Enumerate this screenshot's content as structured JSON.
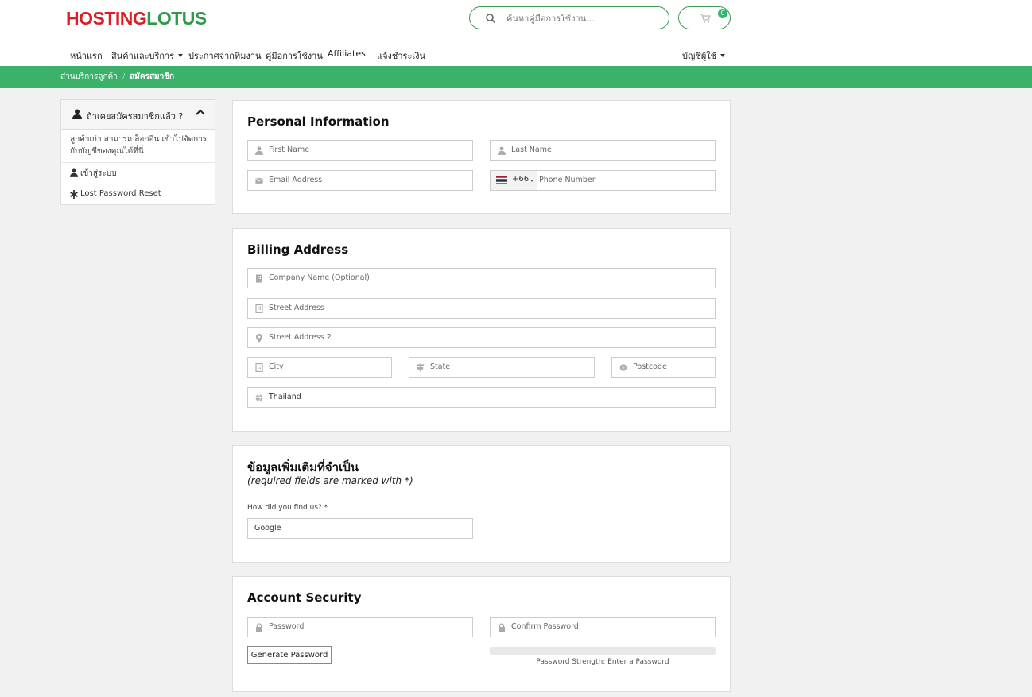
{
  "brand": {
    "part1": "HOSTING",
    "part2": "LOTUS",
    "color_red": "#d81f26",
    "color_green": "#2e9a47"
  },
  "search": {
    "placeholder": "ค้นหาคู่มือการใช้งาน..."
  },
  "cart": {
    "count": "0"
  },
  "nav": {
    "items": [
      "หน้าแรก",
      "สินค้าและบริการ",
      "ประกาศจากทีมงาน",
      "คู่มือการใช้งาน",
      "Affiliates",
      "แจ้งชำระเงิน"
    ],
    "account": "บัญชีผู้ใช้"
  },
  "breadcrumb": {
    "home": "ส่วนบริการลูกค้า",
    "sep": "/",
    "current": "สมัครสมาชิก"
  },
  "sidebar": {
    "title": "ถ้าเคยสมัครสมาชิกแล้ว ?",
    "text": "ลูกค้าเก่า สามารถ ล็อกอิน เข้าไปจัดการกับบัญชีของคุณได้ที่นี่",
    "login": "เข้าสู่ระบบ",
    "reset": "Lost Password Reset"
  },
  "personal": {
    "title": "Personal Information",
    "first_name": "First Name",
    "last_name": "Last Name",
    "email": "Email Address",
    "phone_code": "+66",
    "phone": "Phone Number"
  },
  "billing": {
    "title": "Billing Address",
    "company": "Company Name (Optional)",
    "street": "Street Address",
    "street2": "Street Address 2",
    "city": "City",
    "state": "State",
    "postcode": "Postcode",
    "country": "Thailand"
  },
  "extra": {
    "title": "ข้อมูลเพิ่มเติมที่จำเป็น",
    "subtitle": "(required fields are marked with *)",
    "question": "How did you find us? *",
    "answer": "Google"
  },
  "security": {
    "title": "Account Security",
    "password": "Password",
    "confirm": "Confirm Password",
    "generate": "Generate Password",
    "strength": "Password Strength: Enter a Password"
  },
  "colors": {
    "accent": "#3bb16a",
    "border": "#3d9b55"
  }
}
